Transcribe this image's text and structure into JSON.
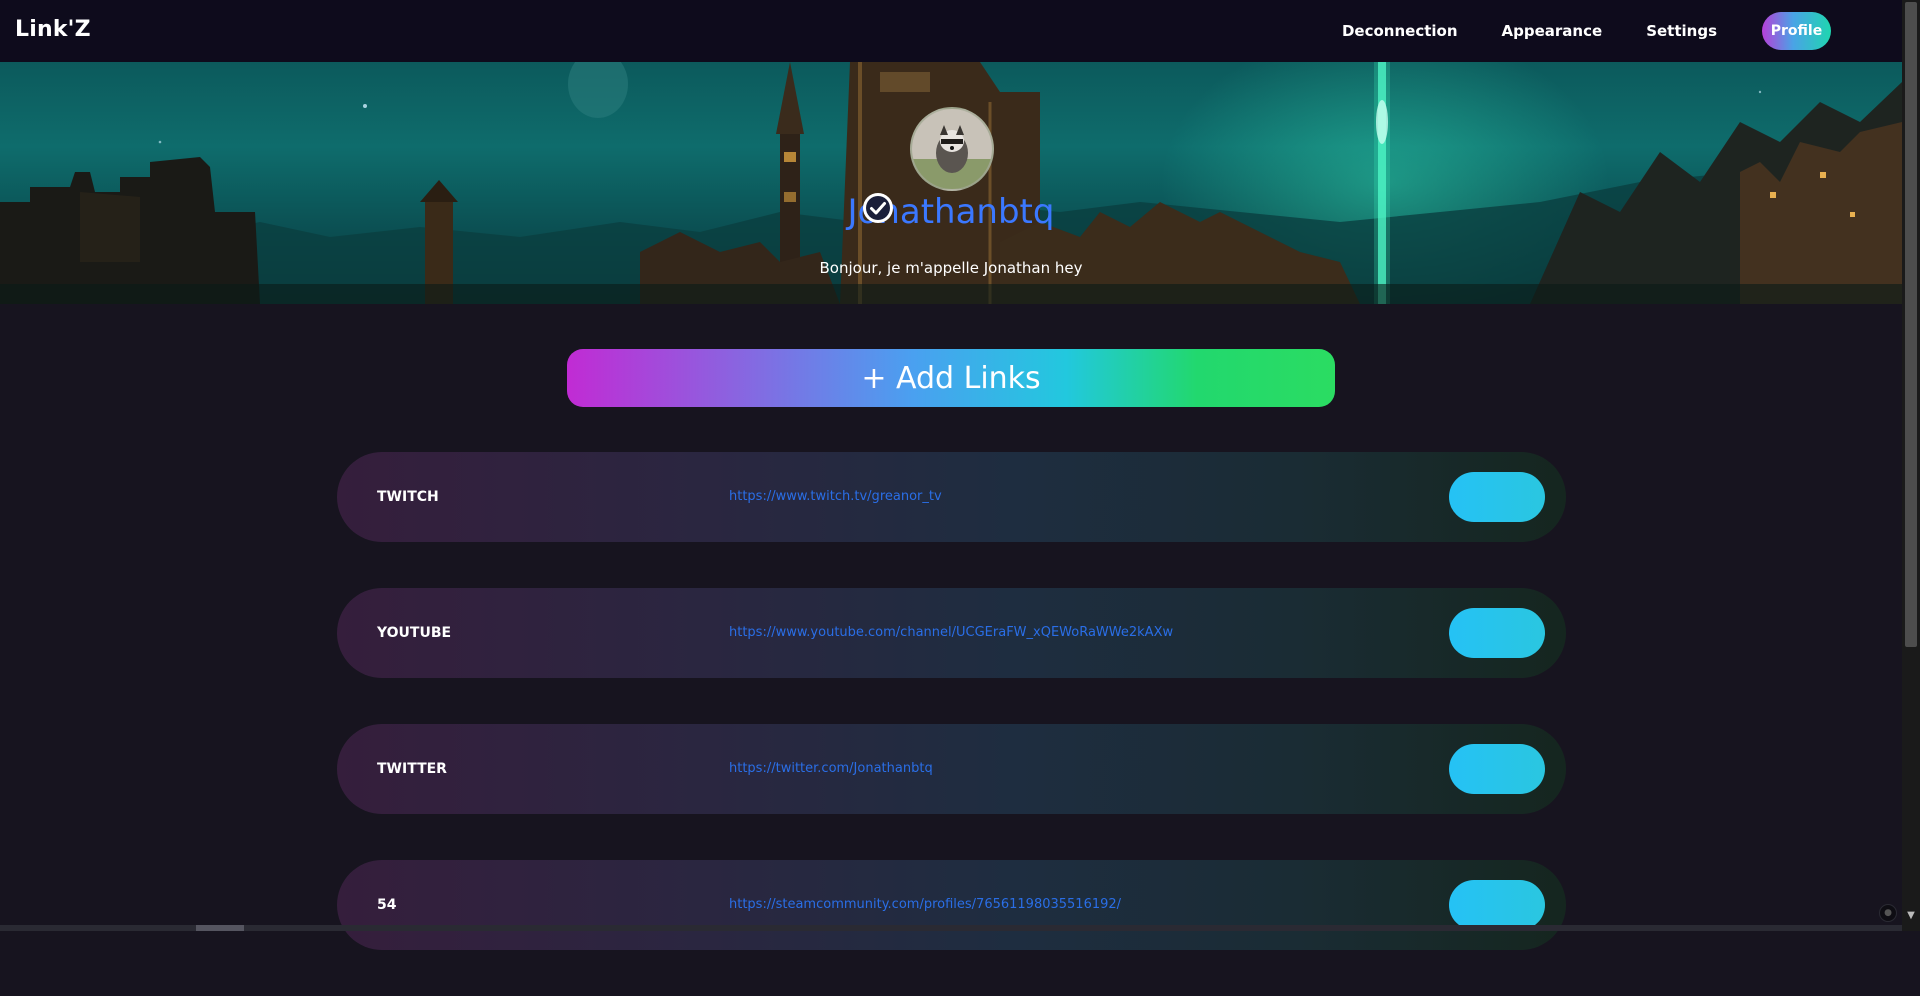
{
  "navbar": {
    "brand": "Link'Z",
    "links": [
      "Deconnection",
      "Appearance",
      "Settings"
    ],
    "profile_label": "Profile"
  },
  "profile": {
    "username": "Jonathanbtq",
    "bio": "Bonjour, je m'appelle Jonathan hey",
    "verified_icon": "check-circle-icon",
    "avatar": "raccoon-photo"
  },
  "add_links": {
    "label": "+ Add Links"
  },
  "links": [
    {
      "title": "TWITCH",
      "url": "https://www.twitch.tv/greanor_tv"
    },
    {
      "title": "YOUTUBE",
      "url": "https://www.youtube.com/channel/UCGEraFW_xQEWoRaWWe2kAXw"
    },
    {
      "title": "TWITTER",
      "url": "https://twitter.com/Jonathanbtq"
    },
    {
      "title": "54",
      "url": "https://steamcommunity.com/profiles/76561198035516192/"
    }
  ],
  "colors": {
    "navbar_bg": "#0e0b1c",
    "page_bg": "#17141f",
    "username": "#3b78ff",
    "link_url": "#2a6ee6",
    "card_button": "#25c2f5"
  }
}
